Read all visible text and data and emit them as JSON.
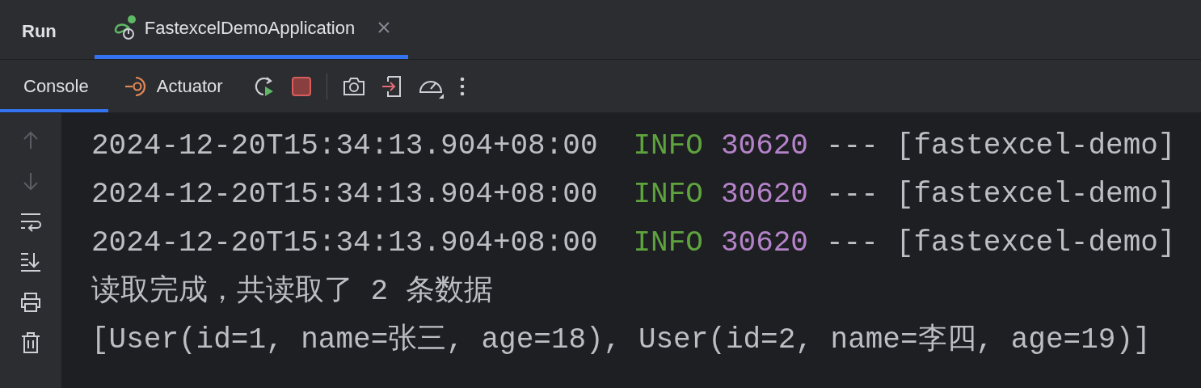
{
  "tool_window": {
    "title": "Run"
  },
  "run_tabs": [
    {
      "label": "FastexcelDemoApplication",
      "selected": true,
      "closable": true
    }
  ],
  "console_tabs": [
    {
      "label": "Console",
      "selected": true,
      "kind": "plain"
    },
    {
      "label": "Actuator",
      "selected": false,
      "kind": "actuator"
    }
  ],
  "sidebar": [
    {
      "kind": "up",
      "disabled": true
    },
    {
      "kind": "down",
      "disabled": true
    },
    {
      "kind": "wrap",
      "disabled": false
    },
    {
      "kind": "scroll-end",
      "disabled": false
    },
    {
      "kind": "print",
      "disabled": false
    },
    {
      "kind": "trash",
      "disabled": false
    }
  ],
  "console_lines": [
    {
      "segments": [
        {
          "text": "2024-12-20T15:34:13.904+08:00",
          "kind": "plain"
        },
        {
          "text": "INFO",
          "kind": "level"
        },
        {
          "text": "30620",
          "kind": "pid"
        },
        {
          "text": "---",
          "kind": "plain"
        },
        {
          "text": "[fastexcel-demo]",
          "kind": "plain"
        }
      ]
    },
    {
      "segments": [
        {
          "text": "2024-12-20T15:34:13.904+08:00",
          "kind": "plain"
        },
        {
          "text": "INFO",
          "kind": "level"
        },
        {
          "text": "30620",
          "kind": "pid"
        },
        {
          "text": "---",
          "kind": "plain"
        },
        {
          "text": "[fastexcel-demo]",
          "kind": "plain"
        }
      ]
    },
    {
      "segments": [
        {
          "text": "2024-12-20T15:34:13.904+08:00",
          "kind": "plain"
        },
        {
          "text": "INFO",
          "kind": "level"
        },
        {
          "text": "30620",
          "kind": "pid"
        },
        {
          "text": "---",
          "kind": "plain"
        },
        {
          "text": "[fastexcel-demo]",
          "kind": "plain"
        }
      ]
    },
    {
      "segments": [
        {
          "text": "读取完成，共读取了 2 条数据",
          "kind": "plain"
        }
      ]
    },
    {
      "segments": [
        {
          "text": "[User(id=1, name=张三, age=18), User(id=2, name=李四, age=19)]",
          "kind": "plain"
        }
      ]
    }
  ]
}
